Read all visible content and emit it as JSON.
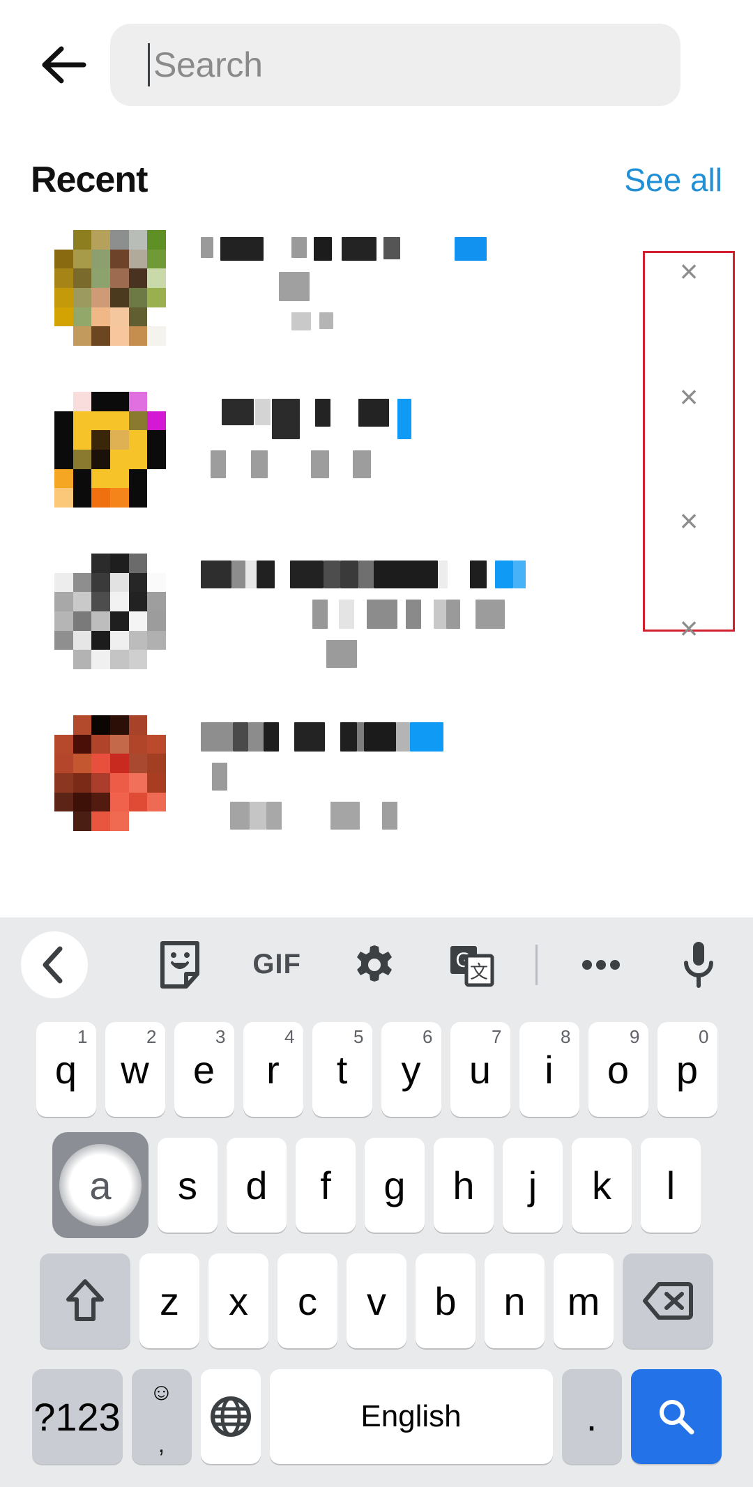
{
  "header": {
    "back_icon": "back-arrow-icon",
    "search_placeholder": "Search",
    "search_value": ""
  },
  "recent_section": {
    "title": "Recent",
    "see_all_label": "See all",
    "items": [
      {
        "title_redacted": true,
        "subtitle_redacted": true,
        "remove_label": "×",
        "avatar_colors": [
          "#ffffff",
          "#8d7f1f",
          "#b5a05c",
          "#8c8f8d",
          "#b8bdb7",
          "#5f9026",
          "#8a6a11",
          "#a79b49",
          "#8d9e6f",
          "#6d4329",
          "#b1a99a",
          "#6f9a36",
          "#a68416",
          "#7a6a2b",
          "#8ca36d",
          "#9d6b4f",
          "#4a3220",
          "#c9d9a9",
          "#c59a0a",
          "#9c9a5e",
          "#cf9b77",
          "#4b3a1d",
          "#6e7a45",
          "#9ab04e",
          "#d2a303",
          "#92a86a",
          "#f0b887",
          "#f5c79e",
          "#615f32",
          "#ffffff",
          "#ffffff",
          "#c39a5e",
          "#6b4620",
          "#f7c69c",
          "#c58d4e",
          "#f5f3ee"
        ]
      },
      {
        "title_redacted": true,
        "subtitle_redacted": true,
        "remove_label": "×",
        "avatar_colors": [
          "#ffffff",
          "#f9dcdc",
          "#0b0b0b",
          "#0b0b0b",
          "#e06fe0",
          "#ffffff",
          "#0b0b0b",
          "#f6c429",
          "#f6c429",
          "#f6c429",
          "#8a7a2f",
          "#d419d4",
          "#0b0b0b",
          "#f6c429",
          "#3a2608",
          "#e0b152",
          "#f6c429",
          "#0b0b0b",
          "#0b0b0b",
          "#8a7a2f",
          "#1b1108",
          "#f6c429",
          "#f6c429",
          "#0b0b0b",
          "#f5a623",
          "#0b0b0b",
          "#f6c429",
          "#f6c429",
          "#0b0b0b",
          "#ffffff",
          "#fbc87a",
          "#0b0b0b",
          "#f07010",
          "#f5841a",
          "#0b0b0b",
          "#ffffff"
        ]
      },
      {
        "title_redacted": true,
        "subtitle_redacted": true,
        "remove_label": "×",
        "avatar_colors": [
          "#ffffff",
          "#ffffff",
          "#2b2b2b",
          "#1e1e1e",
          "#6b6b6b",
          "#ffffff",
          "#ededed",
          "#8e8e8e",
          "#3a3a3a",
          "#e2e2e2",
          "#262626",
          "#fafafa",
          "#a8a8a8",
          "#c9c9c9",
          "#4d4d4d",
          "#f2f2f2",
          "#222222",
          "#9e9e9e",
          "#b5b5b5",
          "#7a7a7a",
          "#bdbdbd",
          "#1f1f1f",
          "#f4f4f4",
          "#9c9c9c",
          "#8f8f8f",
          "#e6e6e6",
          "#1c1c1c",
          "#efefef",
          "#bcbcbc",
          "#b0b0b0",
          "#ffffff",
          "#b3b3b3",
          "#f0f0f0",
          "#c4c4c4",
          "#cfcfcf",
          "#ffffff"
        ]
      },
      {
        "title_redacted": true,
        "subtitle_redacted": true,
        "remove_label": "×",
        "avatar_colors": [
          "#ffffff",
          "#b34a2c",
          "#0c0603",
          "#2c1007",
          "#a8432a",
          "#ffffff",
          "#b6482c",
          "#4a1008",
          "#b0442b",
          "#c46a4a",
          "#b1452a",
          "#bb4a2c",
          "#b4462b",
          "#c4572f",
          "#e8503d",
          "#c82a1f",
          "#a94a30",
          "#a23e22",
          "#8a3620",
          "#7a2a16",
          "#aa3d2c",
          "#ec5c46",
          "#f1705a",
          "#a83d22",
          "#5c2416",
          "#3d1008",
          "#531a10",
          "#f0624c",
          "#e04b36",
          "#ef6a52",
          "#ffffff",
          "#4a1e13",
          "#e85640",
          "#f06a52",
          "#ffffff",
          "#ffffff"
        ]
      }
    ]
  },
  "annotation": {
    "box_color": "#d32030",
    "target": "remove-recent-buttons-column"
  },
  "keyboard": {
    "toolbar": [
      {
        "name": "back-chevron-icon",
        "label": "‹"
      },
      {
        "name": "sticker-icon",
        "label": ""
      },
      {
        "name": "gif-icon",
        "label": "GIF"
      },
      {
        "name": "settings-gear-icon",
        "label": ""
      },
      {
        "name": "translate-icon",
        "label": ""
      },
      {
        "name": "more-options-icon",
        "label": "•••"
      },
      {
        "name": "microphone-icon",
        "label": ""
      }
    ],
    "row1": [
      {
        "key": "q",
        "num": "1"
      },
      {
        "key": "w",
        "num": "2"
      },
      {
        "key": "e",
        "num": "3"
      },
      {
        "key": "r",
        "num": "4"
      },
      {
        "key": "t",
        "num": "5"
      },
      {
        "key": "y",
        "num": "6"
      },
      {
        "key": "u",
        "num": "7"
      },
      {
        "key": "i",
        "num": "8"
      },
      {
        "key": "o",
        "num": "9"
      },
      {
        "key": "p",
        "num": "0"
      }
    ],
    "row2": [
      {
        "key": "a",
        "pressed": true
      },
      {
        "key": "s"
      },
      {
        "key": "d"
      },
      {
        "key": "f"
      },
      {
        "key": "g"
      },
      {
        "key": "h"
      },
      {
        "key": "j"
      },
      {
        "key": "k"
      },
      {
        "key": "l"
      }
    ],
    "row3": {
      "shift_label": "",
      "letters": [
        "z",
        "x",
        "c",
        "v",
        "b",
        "n",
        "m"
      ],
      "backspace_label": ""
    },
    "row4": {
      "symbols_label": "?123",
      "emoji_label": "☺",
      "comma_label": ",",
      "globe_label": "",
      "space_label": "English",
      "period_label": ".",
      "search_label": ""
    },
    "accent_blue": "#2372e8"
  }
}
